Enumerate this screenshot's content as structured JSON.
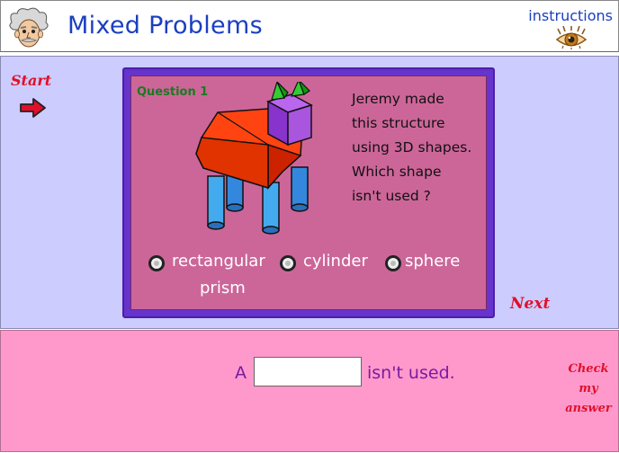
{
  "header": {
    "title": "Mixed Problems",
    "instructions_label": "instructions",
    "mascot_icon": "einstein-face-icon",
    "instructions_icon": "eye-icon"
  },
  "nav": {
    "start_label": "Start",
    "start_icon": "right-arrow-icon",
    "next_label": "Next"
  },
  "question": {
    "number": "Question 1",
    "text": "Jeremy made\nthis structure\nusing 3D shapes.\nWhich shape\nisn't used ?",
    "options": [
      {
        "label": "rectangular",
        "label_line2": "prism"
      },
      {
        "label": "cylinder"
      },
      {
        "label": "sphere"
      }
    ]
  },
  "answer": {
    "prefix": "A",
    "value": "",
    "suffix": "isn't used.",
    "check_line1": "Check",
    "check_line2": "my",
    "check_line3": "answer"
  },
  "colors": {
    "header_bg": "#ffffff",
    "title": "#1a3fc0",
    "upper_bg": "#ccccff",
    "card_border": "#6633cc",
    "card_bg": "#cc6699",
    "lower_bg": "#ff99cc",
    "action_red": "#e0102a",
    "question_number": "#1a7a20"
  }
}
